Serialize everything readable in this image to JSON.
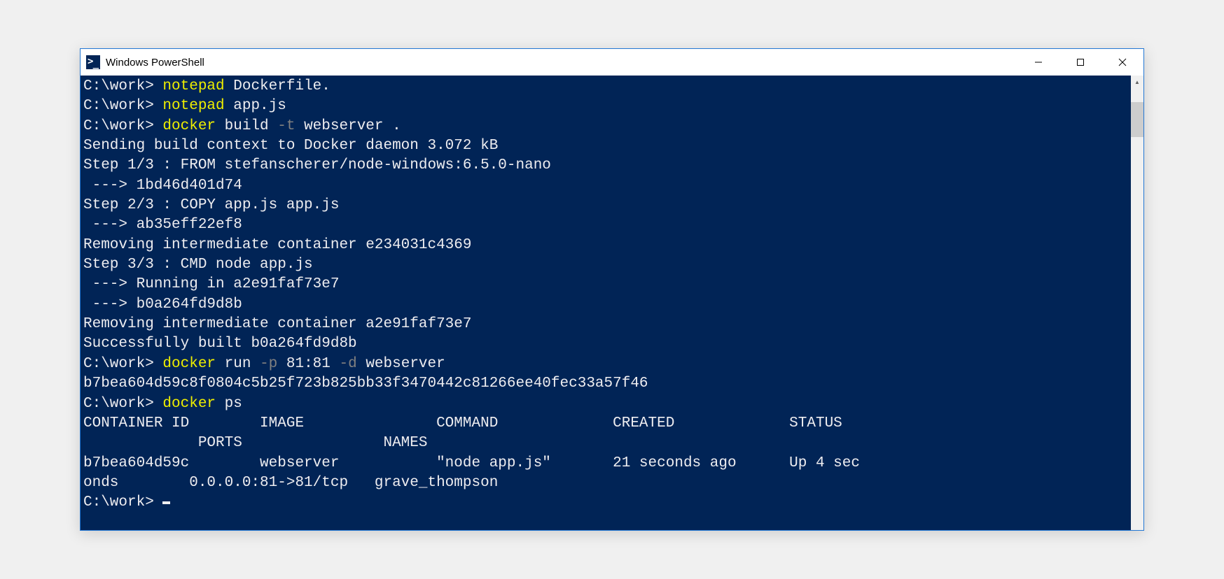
{
  "window": {
    "title": "Windows PowerShell"
  },
  "prompt": "C:\\work> ",
  "lines": [
    {
      "segments": [
        {
          "text": "C:\\work> ",
          "cls": "c-white"
        },
        {
          "text": "notepad ",
          "cls": "c-yellow"
        },
        {
          "text": "Dockerfile.",
          "cls": "c-white"
        }
      ]
    },
    {
      "segments": [
        {
          "text": "C:\\work> ",
          "cls": "c-white"
        },
        {
          "text": "notepad ",
          "cls": "c-yellow"
        },
        {
          "text": "app.js",
          "cls": "c-white"
        }
      ]
    },
    {
      "segments": [
        {
          "text": "C:\\work> ",
          "cls": "c-white"
        },
        {
          "text": "docker ",
          "cls": "c-yellow"
        },
        {
          "text": "build ",
          "cls": "c-white"
        },
        {
          "text": "-t ",
          "cls": "c-gray"
        },
        {
          "text": "webserver .",
          "cls": "c-white"
        }
      ]
    },
    {
      "segments": [
        {
          "text": "Sending build context to Docker daemon 3.072 kB",
          "cls": "c-white"
        }
      ]
    },
    {
      "segments": [
        {
          "text": "Step 1/3 : FROM stefanscherer/node-windows:6.5.0-nano",
          "cls": "c-white"
        }
      ]
    },
    {
      "segments": [
        {
          "text": " ---> 1bd46d401d74",
          "cls": "c-white"
        }
      ]
    },
    {
      "segments": [
        {
          "text": "Step 2/3 : COPY app.js app.js",
          "cls": "c-white"
        }
      ]
    },
    {
      "segments": [
        {
          "text": " ---> ab35eff22ef8",
          "cls": "c-white"
        }
      ]
    },
    {
      "segments": [
        {
          "text": "Removing intermediate container e234031c4369",
          "cls": "c-white"
        }
      ]
    },
    {
      "segments": [
        {
          "text": "Step 3/3 : CMD node app.js",
          "cls": "c-white"
        }
      ]
    },
    {
      "segments": [
        {
          "text": " ---> Running in a2e91faf73e7",
          "cls": "c-white"
        }
      ]
    },
    {
      "segments": [
        {
          "text": " ---> b0a264fd9d8b",
          "cls": "c-white"
        }
      ]
    },
    {
      "segments": [
        {
          "text": "Removing intermediate container a2e91faf73e7",
          "cls": "c-white"
        }
      ]
    },
    {
      "segments": [
        {
          "text": "Successfully built b0a264fd9d8b",
          "cls": "c-white"
        }
      ]
    },
    {
      "segments": [
        {
          "text": "C:\\work> ",
          "cls": "c-white"
        },
        {
          "text": "docker ",
          "cls": "c-yellow"
        },
        {
          "text": "run ",
          "cls": "c-white"
        },
        {
          "text": "-p ",
          "cls": "c-gray"
        },
        {
          "text": "81:81 ",
          "cls": "c-white"
        },
        {
          "text": "-d ",
          "cls": "c-gray"
        },
        {
          "text": "webserver",
          "cls": "c-white"
        }
      ]
    },
    {
      "segments": [
        {
          "text": "b7bea604d59c8f0804c5b25f723b825bb33f3470442c81266ee40fec33a57f46",
          "cls": "c-white"
        }
      ]
    },
    {
      "segments": [
        {
          "text": "C:\\work> ",
          "cls": "c-white"
        },
        {
          "text": "docker ",
          "cls": "c-yellow"
        },
        {
          "text": "ps",
          "cls": "c-white"
        }
      ]
    },
    {
      "segments": [
        {
          "text": "CONTAINER ID        IMAGE               COMMAND             CREATED             STATUS",
          "cls": "c-white"
        }
      ]
    },
    {
      "segments": [
        {
          "text": "             PORTS                NAMES",
          "cls": "c-white"
        }
      ]
    },
    {
      "segments": [
        {
          "text": "b7bea604d59c        webserver           \"node app.js\"       21 seconds ago      Up 4 sec",
          "cls": "c-white"
        }
      ]
    },
    {
      "segments": [
        {
          "text": "onds        0.0.0.0:81->81/tcp   grave_thompson",
          "cls": "c-white"
        }
      ]
    },
    {
      "segments": [
        {
          "text": "C:\\work> ",
          "cls": "c-white"
        }
      ],
      "cursor": true
    }
  ]
}
